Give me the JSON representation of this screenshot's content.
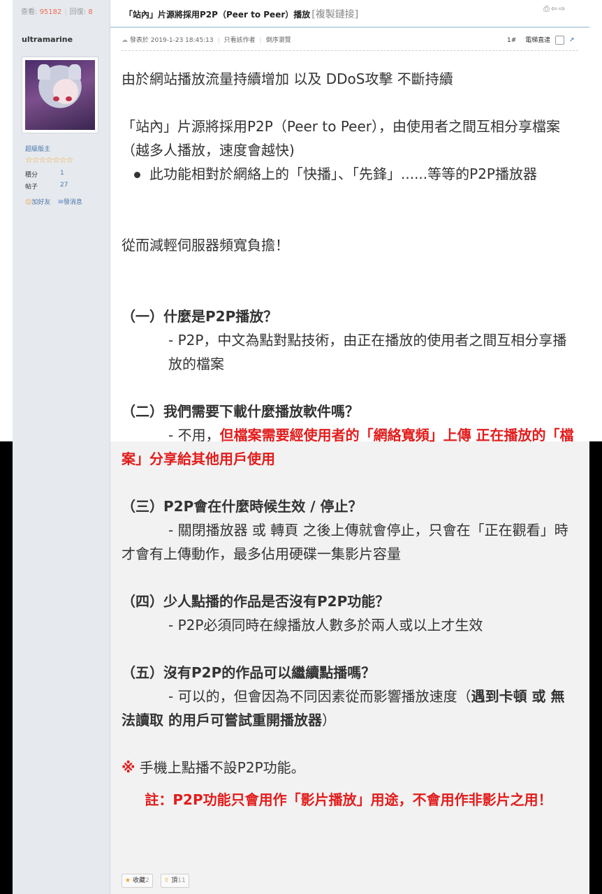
{
  "thread": {
    "views_label": "查看:",
    "views": "95182",
    "replies_label": "回復:",
    "replies": "8",
    "title": "「站內」片源將採用P2P（Peer to Peer）播放",
    "copy_link": "[複製鏈接]"
  },
  "author": {
    "name": "ultramarine",
    "rank": "超級版主",
    "stars": "☆☆☆☆☆☆☆",
    "points_label": "積分",
    "points": "1",
    "posts_label": "帖子",
    "posts": "27",
    "add_friend": "加好友",
    "send_message": "發消息"
  },
  "post_meta": {
    "posted": "發表於 2019-1-23 18:45:13",
    "author_only": "只看該作者",
    "reverse": "倒序瀏覽",
    "floor": "1#",
    "elevator": "電梯直達"
  },
  "content": {
    "p1": "由於網站播放流量持續增加 以及 DDoS攻擊 不斷持續",
    "p2": "「站內」片源將採用P2P（Peer to Peer），由使用者之間互相分享檔案（越多人播放，速度會越快)",
    "bullet1": "此功能相對於網絡上的「快播」、「先鋒」......等等的P2P播放器",
    "p3": "從而減輕伺服器頻寬負擔！",
    "q1_title": "（一）什麼是P2P播放？",
    "q1_answer": "- P2P，中文為點對點技術，由正在播放的使用者之間互相分享播放的檔案",
    "q2_title": "（二）我們需要下載什麼播放軟件嗎？",
    "q2_answer_plain": "- 不用，",
    "q2_answer_red": "但檔案需要經使用者的「網絡寬頻」上傳 正在播放的「檔案」分享給其他用戶使用",
    "q3_title": "（三）P2P會在什麼時候生效 / 停止？",
    "q3_answer": "- 關閉播放器 或 轉頁 之後上傳就會停止，只會在「正在觀看」時才會有上傳動作，最多佔用硬碟一集影片容量",
    "q4_title": "（四）少人點播的作品是否沒有P2P功能？",
    "q4_answer": "- P2P必須同時在線播放人數多於兩人或以上才生效",
    "q5_title": "（五）沒有P2P的作品可以繼續點播嗎？",
    "q5_answer_plain": "- 可以的，但會因為不同因素從而影響播放速度（",
    "q5_answer_bold": "遇到卡頓 或 無法讀取 的用戶可嘗試重開播放器",
    "q5_answer_end": "）",
    "mobile_mark": "※",
    "mobile_note": " 手機上點播不設P2P功能。",
    "footnote": "註：P2P功能只會用作「影片播放」用途，不會用作非影片之用！"
  },
  "buttons": {
    "favorite_label": "收藏",
    "favorite_count": "2",
    "top_label": "頂",
    "top_count": "11"
  },
  "colors": {
    "accent_red": "#e21c1c",
    "link_blue": "#4d77a9",
    "sidebar_bg": "#e6e9ee"
  }
}
